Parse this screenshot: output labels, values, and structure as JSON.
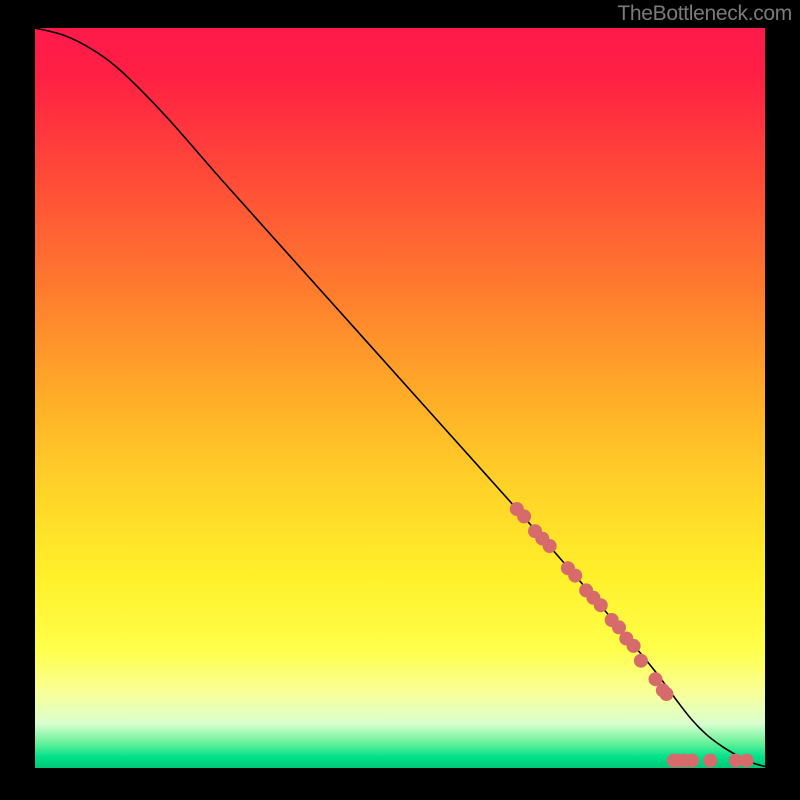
{
  "attribution": "TheBottleneck.com",
  "chart_data": {
    "type": "line",
    "xlabel": "",
    "ylabel": "",
    "xlim": [
      0,
      100
    ],
    "ylim": [
      0,
      100
    ],
    "title": "",
    "background_gradient": {
      "stops": [
        {
          "offset": 0.0,
          "color": "#ff1a4a"
        },
        {
          "offset": 0.06,
          "color": "#ff1f44"
        },
        {
          "offset": 0.2,
          "color": "#ff4a38"
        },
        {
          "offset": 0.35,
          "color": "#ff7a2e"
        },
        {
          "offset": 0.5,
          "color": "#ffad28"
        },
        {
          "offset": 0.62,
          "color": "#ffd228"
        },
        {
          "offset": 0.74,
          "color": "#fff02a"
        },
        {
          "offset": 0.84,
          "color": "#ffff4a"
        },
        {
          "offset": 0.9,
          "color": "#f8ff9a"
        },
        {
          "offset": 0.94,
          "color": "#d9ffcf"
        },
        {
          "offset": 0.965,
          "color": "#6cf29b"
        },
        {
          "offset": 0.985,
          "color": "#00e28a"
        },
        {
          "offset": 1.0,
          "color": "#00c779"
        }
      ]
    },
    "curve": {
      "x": [
        0,
        4,
        8,
        12,
        18,
        26,
        36,
        46,
        56,
        66,
        74,
        80,
        85,
        88,
        90,
        92,
        94,
        96,
        98,
        100
      ],
      "y": [
        100,
        99,
        97,
        94,
        88,
        79,
        68,
        57,
        46,
        35,
        26,
        19,
        13,
        9,
        6.5,
        4.5,
        3,
        1.8,
        0.8,
        0.2
      ]
    },
    "points": {
      "color": "#d76a6a",
      "radius": 7,
      "xy": [
        [
          66,
          35
        ],
        [
          67,
          34
        ],
        [
          68.5,
          32
        ],
        [
          69.5,
          31
        ],
        [
          70.5,
          30
        ],
        [
          73,
          27
        ],
        [
          74,
          26
        ],
        [
          75.5,
          24
        ],
        [
          76.5,
          23
        ],
        [
          77.5,
          22
        ],
        [
          79,
          20
        ],
        [
          80,
          19
        ],
        [
          81,
          17.5
        ],
        [
          82,
          16.5
        ],
        [
          83,
          14.5
        ],
        [
          85,
          12
        ],
        [
          86,
          10.5
        ],
        [
          86.5,
          10
        ],
        [
          87.5,
          1
        ],
        [
          88,
          1
        ],
        [
          89,
          1
        ],
        [
          90,
          1
        ],
        [
          92.5,
          1
        ],
        [
          96,
          1
        ],
        [
          97.5,
          1
        ]
      ]
    }
  }
}
